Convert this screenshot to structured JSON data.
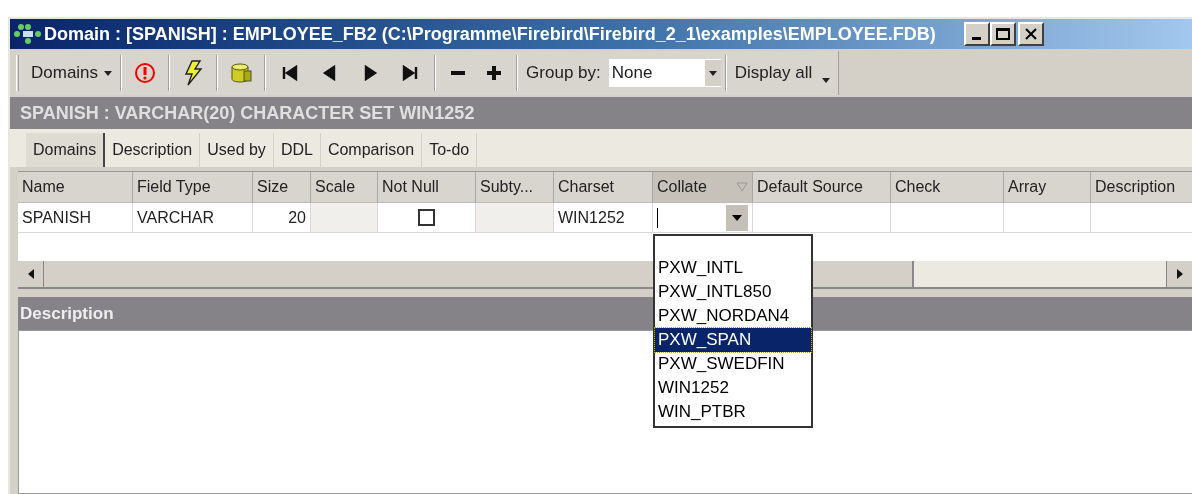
{
  "window": {
    "title": "Domain : [SPANISH] : EMPLOYEE_FB2 (C:\\Programme\\Firebird\\Firebird_2_1\\examples\\EMPLOYEE.FDB)"
  },
  "toolbar": {
    "menu_label": "Domains",
    "group_by_label": "Group by:",
    "group_by_value": "None",
    "display_all": "Display all"
  },
  "header_text": "SPANISH : VARCHAR(20) CHARACTER SET WIN1252",
  "tabs": [
    {
      "label": "Domains",
      "selected": true
    },
    {
      "label": "Description",
      "selected": false
    },
    {
      "label": "Used by",
      "selected": false
    },
    {
      "label": "DDL",
      "selected": false
    },
    {
      "label": "Comparison",
      "selected": false
    },
    {
      "label": "To-do",
      "selected": false
    }
  ],
  "table": {
    "columns": [
      {
        "label": "Name",
        "sorted": false
      },
      {
        "label": "Field Type",
        "sorted": false
      },
      {
        "label": "Size",
        "sorted": false
      },
      {
        "label": "Scale",
        "sorted": false
      },
      {
        "label": "Not Null",
        "sorted": false
      },
      {
        "label": "Subty...",
        "sorted": false
      },
      {
        "label": "Charset",
        "sorted": false
      },
      {
        "label": "Collate",
        "sorted": true
      },
      {
        "label": "Default Source",
        "sorted": false
      },
      {
        "label": "Check",
        "sorted": false
      },
      {
        "label": "Array",
        "sorted": false
      },
      {
        "label": "Description",
        "sorted": false
      }
    ],
    "rows": [
      {
        "cells": [
          {
            "kind": "text",
            "text": "SPANISH"
          },
          {
            "kind": "text",
            "text": "VARCHAR"
          },
          {
            "kind": "number",
            "text": "20"
          },
          {
            "kind": "readonly"
          },
          {
            "kind": "checkbox",
            "checked": false
          },
          {
            "kind": "readonly"
          },
          {
            "kind": "text",
            "text": "WIN1252"
          },
          {
            "kind": "combo",
            "expanded": true,
            "options": [
              {
                "label": "PXW_INTL",
                "selected": false
              },
              {
                "label": "PXW_INTL850",
                "selected": false
              },
              {
                "label": "PXW_NORDAN4",
                "selected": false
              },
              {
                "label": "PXW_SPAN",
                "selected": true
              },
              {
                "label": "PXW_SWEDFIN",
                "selected": false
              },
              {
                "label": "WIN1252",
                "selected": false
              },
              {
                "label": "WIN_PTBR",
                "selected": false
              }
            ]
          },
          {
            "kind": "empty"
          },
          {
            "kind": "empty"
          },
          {
            "kind": "empty"
          },
          {
            "kind": "empty"
          }
        ]
      }
    ]
  },
  "description_panel": {
    "title": "Description"
  }
}
